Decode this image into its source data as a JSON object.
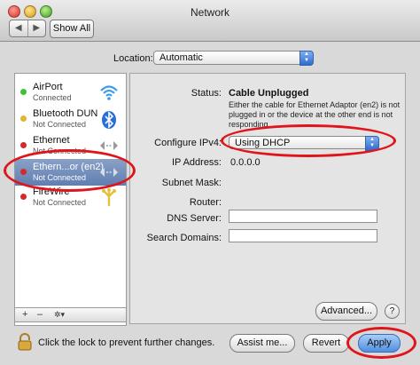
{
  "window": {
    "title": "Network"
  },
  "toolbar": {
    "show_all_label": "Show All"
  },
  "location": {
    "label": "Location:",
    "value": "Automatic"
  },
  "services": [
    {
      "name": "AirPort",
      "status": "Connected",
      "status_color": "#3ac23a",
      "icon": "wifi-icon"
    },
    {
      "name": "Bluetooth DUN",
      "status": "Not Connected",
      "status_color": "#e2b632",
      "icon": "bluetooth-icon"
    },
    {
      "name": "Ethernet",
      "status": "Not Connected",
      "status_color": "#d42a2a",
      "icon": "ethernet-icon"
    },
    {
      "name": "Ethern...or (en2)",
      "status": "Not Connected",
      "status_color": "#d42a2a",
      "icon": "ethernet-icon",
      "selected": true
    },
    {
      "name": "FireWire",
      "status": "Not Connected",
      "status_color": "#d42a2a",
      "icon": "firewire-icon"
    }
  ],
  "sidebar_controls": {
    "add": "+",
    "remove": "–",
    "action": "✲▾"
  },
  "details": {
    "status_label": "Status:",
    "status_value": "Cable Unplugged",
    "status_description": "Either the cable for Ethernet Adaptor (en2) is not plugged in or the device at the other end is not responding.",
    "configure_label": "Configure IPv4:",
    "configure_value": "Using DHCP",
    "ip_label": "IP Address:",
    "ip_value": "0.0.0.0",
    "subnet_label": "Subnet Mask:",
    "router_label": "Router:",
    "dns_label": "DNS Server:",
    "search_label": "Search Domains:"
  },
  "buttons": {
    "advanced": "Advanced...",
    "help": "?",
    "assist": "Assist me...",
    "revert": "Revert",
    "apply": "Apply"
  },
  "lock": {
    "text": "Click the lock to prevent further changes."
  },
  "colors": {
    "annotation_red": "#e0151c",
    "selection_blue": "#6b88b8",
    "popup_blue": "#2e6bd1"
  }
}
